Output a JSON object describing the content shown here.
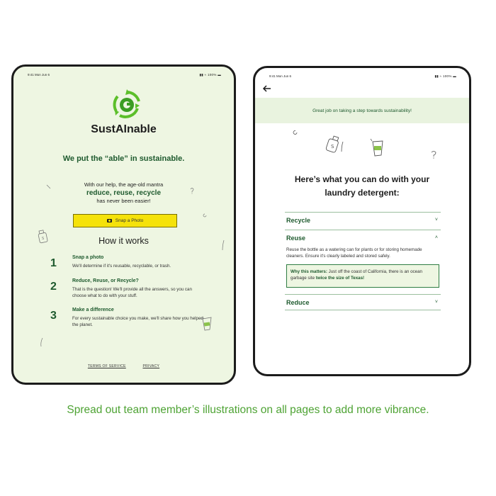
{
  "colors": {
    "brand_green": "#1e5a2e",
    "accent_green": "#4ea334",
    "snap_yellow": "#f5e20a",
    "mint_bg": "#eef6e2"
  },
  "left_screen": {
    "status": {
      "time": "9:41  Mon Jun 6",
      "system": "▮▮ ≈ 100% ▬"
    },
    "brand": "SustAInable",
    "tagline": "We put the “able” in sustainable.",
    "intro_line1": "With our help, the age-old mantra",
    "mantra": "reduce, reuse, recycle",
    "intro_line2": "has never been easier!",
    "snap_button": "Snap a Photo",
    "how_title": "How it works",
    "steps": [
      {
        "num": "1",
        "title": "Snap a photo",
        "desc": "We'll determine if it's reusable, recyclable, or trash."
      },
      {
        "num": "2",
        "title": "Reduce, Reuse, or Recycle?",
        "desc": "That is the question! We'll provide all the answers, so you can choose what to do with your stuff."
      },
      {
        "num": "3",
        "title": "Make a difference",
        "desc": "For every sustainable choice you make, we'll share how you helped the planet."
      }
    ],
    "footer": {
      "terms": "TERMS OF SERVICE",
      "privacy": "PRIVACY"
    }
  },
  "right_screen": {
    "status": {
      "time": "9:41  Mon Jun 6",
      "system": "▮▮ ≈ 100% ▬"
    },
    "banner": "Great job on taking a step towards sustainability!",
    "heading_line1": "Here’s what you can do with your",
    "heading_line2": "laundry detergent:",
    "accordion": {
      "recycle": "Recycle",
      "reuse": "Reuse",
      "reuse_text": "Reuse the bottle as a watering can for plants or for storing homemade cleaners. Ensure it's clearly labeled and stored safely.",
      "why_label": "Why this matters:",
      "why_text": " Just off the coast of California, there is an ocean garbage site ",
      "why_bold": "twice the size of Texas!",
      "reduce": "Reduce",
      "chev_down": "˅",
      "chev_up": "˄"
    }
  },
  "caption": "Spread out team member’s illustrations on all pages to add more vibrance."
}
